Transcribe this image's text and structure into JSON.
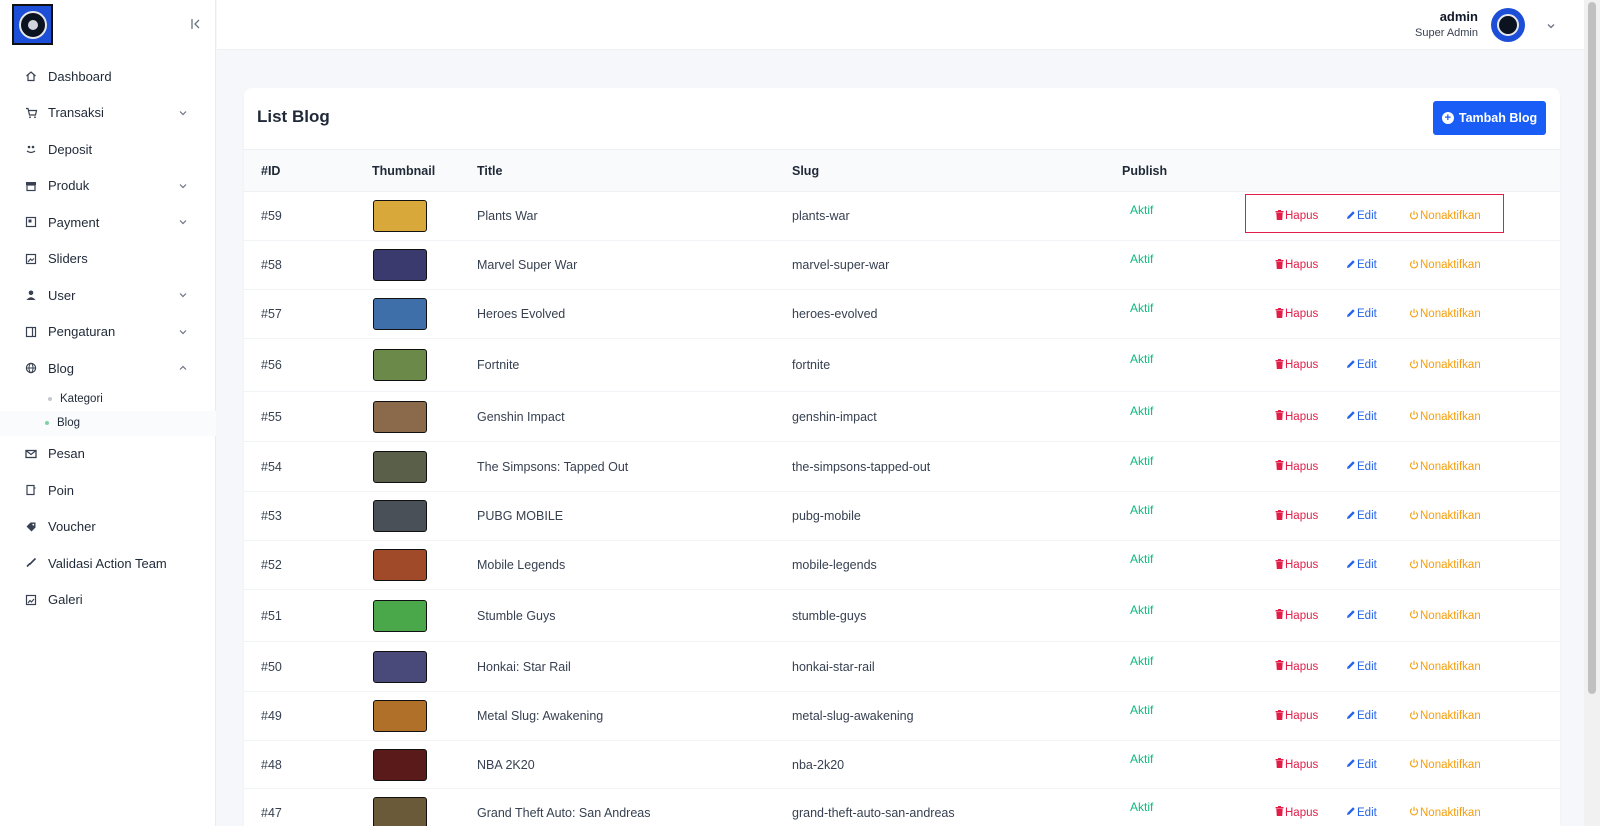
{
  "sidebar": {
    "collapse_icon": "collapse-left-icon",
    "items": [
      {
        "label": "Dashboard",
        "icon": "home-icon",
        "has_children": false
      },
      {
        "label": "Transaksi",
        "icon": "cart-icon",
        "has_children": true
      },
      {
        "label": "Deposit",
        "icon": "wallet-icon",
        "has_children": false
      },
      {
        "label": "Produk",
        "icon": "store-icon",
        "has_children": true
      },
      {
        "label": "Payment",
        "icon": "payment-icon",
        "has_children": true
      },
      {
        "label": "Sliders",
        "icon": "image-icon",
        "has_children": false
      },
      {
        "label": "User",
        "icon": "user-icon",
        "has_children": true
      },
      {
        "label": "Pengaturan",
        "icon": "settings-icon",
        "has_children": true
      },
      {
        "label": "Blog",
        "icon": "globe-icon",
        "has_children": true,
        "expanded": true
      }
    ],
    "blog_sub": [
      {
        "label": "Kategori"
      },
      {
        "label": "Blog",
        "active": true
      }
    ],
    "items_after": [
      {
        "label": "Pesan",
        "icon": "mail-icon"
      },
      {
        "label": "Poin",
        "icon": "coin-icon"
      },
      {
        "label": "Voucher",
        "icon": "tag-icon"
      },
      {
        "label": "Validasi Action Team",
        "icon": "check-icon"
      },
      {
        "label": "Galeri",
        "icon": "gallery-icon"
      }
    ]
  },
  "header": {
    "user_name": "admin",
    "user_role": "Super Admin"
  },
  "card": {
    "title": "List Blog",
    "add_button": "Tambah Blog"
  },
  "table": {
    "columns": [
      "#ID",
      "Thumbnail",
      "Title",
      "Slug",
      "Publish"
    ],
    "rows": [
      {
        "id": "#59",
        "title": "Plants War",
        "slug": "plants-war",
        "publish": "Aktif",
        "thumb_color": "#d8a93a"
      },
      {
        "id": "#58",
        "title": "Marvel Super War",
        "slug": "marvel-super-war",
        "publish": "Aktif",
        "thumb_color": "#3b3a6e"
      },
      {
        "id": "#57",
        "title": "Heroes Evolved",
        "slug": "heroes-evolved",
        "publish": "Aktif",
        "thumb_color": "#3f6fa8"
      },
      {
        "id": "#56",
        "title": "Fortnite",
        "slug": "fortnite",
        "publish": "Aktif",
        "thumb_color": "#6b8a4a"
      },
      {
        "id": "#55",
        "title": "Genshin Impact",
        "slug": "genshin-impact",
        "publish": "Aktif",
        "thumb_color": "#8a6a4a"
      },
      {
        "id": "#54",
        "title": "The Simpsons: Tapped Out",
        "slug": "the-simpsons-tapped-out",
        "publish": "Aktif",
        "thumb_color": "#5a5f4a"
      },
      {
        "id": "#53",
        "title": "PUBG MOBILE",
        "slug": "pubg-mobile",
        "publish": "Aktif",
        "thumb_color": "#4a5058"
      },
      {
        "id": "#52",
        "title": "Mobile Legends",
        "slug": "mobile-legends",
        "publish": "Aktif",
        "thumb_color": "#a04a2a"
      },
      {
        "id": "#51",
        "title": "Stumble Guys",
        "slug": "stumble-guys",
        "publish": "Aktif",
        "thumb_color": "#4aa84a"
      },
      {
        "id": "#50",
        "title": "Honkai: Star Rail",
        "slug": "honkai-star-rail",
        "publish": "Aktif",
        "thumb_color": "#4a4a7a"
      },
      {
        "id": "#49",
        "title": "Metal Slug: Awakening",
        "slug": "metal-slug-awakening",
        "publish": "Aktif",
        "thumb_color": "#b0702a"
      },
      {
        "id": "#48",
        "title": "NBA 2K20",
        "slug": "nba-2k20",
        "publish": "Aktif",
        "thumb_color": "#5a1a1a"
      },
      {
        "id": "#47",
        "title": "Grand Theft Auto: San Andreas",
        "slug": "grand-theft-auto-san-andreas",
        "publish": "Aktif",
        "thumb_color": "#6a5a3a"
      }
    ],
    "actions": {
      "delete": "Hapus",
      "edit": "Edit",
      "deactivate": "Nonaktifkan"
    }
  },
  "colors": {
    "primary": "#1a5df6",
    "success": "#10b981",
    "danger": "#e11d48",
    "warning": "#f59e0b",
    "edit": "#2563eb"
  }
}
